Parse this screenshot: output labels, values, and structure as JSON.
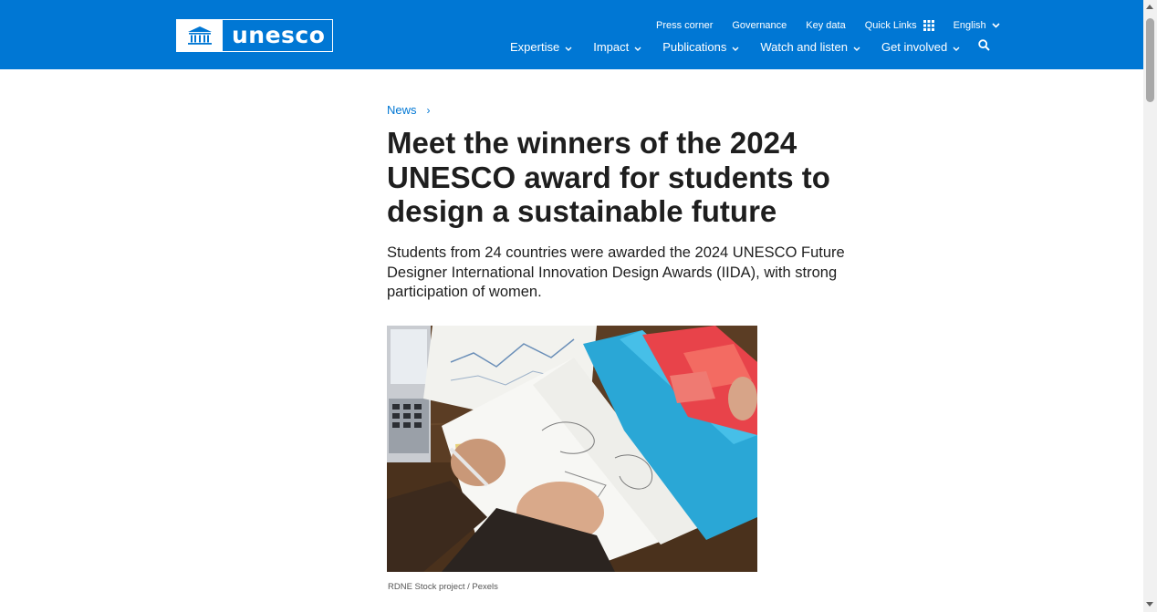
{
  "brand": {
    "name": "unesco"
  },
  "header": {
    "top_links": {
      "press": "Press corner",
      "governance": "Governance",
      "key_data": "Key data",
      "quick_links": "Quick Links",
      "language": "English"
    },
    "nav": {
      "expertise": "Expertise",
      "impact": "Impact",
      "publications": "Publications",
      "watch": "Watch and listen",
      "involved": "Get involved"
    }
  },
  "breadcrumb": {
    "link": "News",
    "separator": "›"
  },
  "article": {
    "title": "Meet the winners of the 2024 UNESCO award for students to design a sustainable future",
    "lede": "Students from 24 countries were awarded the 2024 UNESCO Future Designer International Innovation Design Awards (IIDA), with strong participation of women.",
    "image_caption": "RDNE Stock project / Pexels"
  },
  "colors": {
    "brand_blue": "#0077d4",
    "title_text": "#1e1e1e"
  },
  "icons": [
    "temple-logo-icon",
    "grid-icon",
    "chevron-down-icon",
    "search-icon"
  ]
}
